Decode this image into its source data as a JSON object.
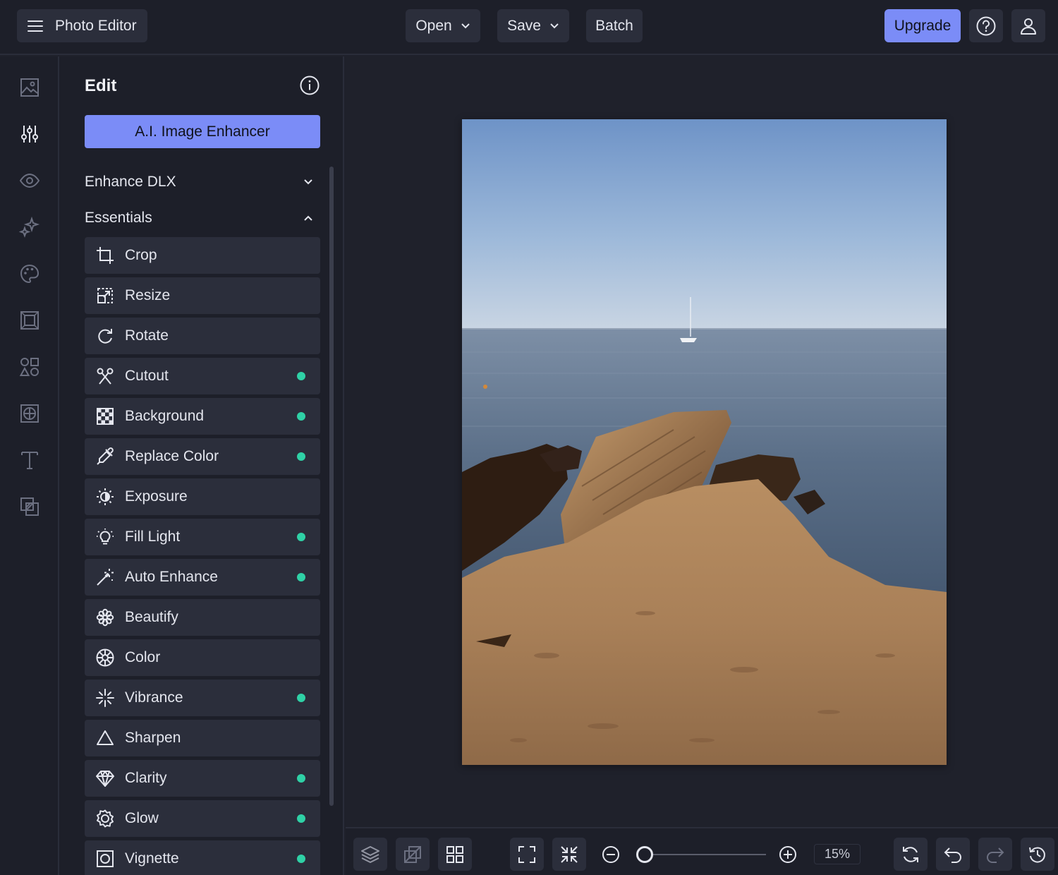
{
  "app": {
    "title": "Photo Editor"
  },
  "topbar": {
    "open_label": "Open",
    "save_label": "Save",
    "batch_label": "Batch",
    "upgrade_label": "Upgrade"
  },
  "rail": {
    "items": [
      "image-icon",
      "sliders-icon",
      "eye-icon",
      "sparkles-icon",
      "palette-icon",
      "frame-icon",
      "shapes-icon",
      "texture-icon",
      "text-icon",
      "overlay-icon"
    ],
    "active": "sliders-icon"
  },
  "panel": {
    "title": "Edit",
    "enhancer_label": "A.I. Image Enhancer",
    "sections": [
      {
        "label": "Enhance DLX",
        "expanded": false
      },
      {
        "label": "Essentials",
        "expanded": true
      }
    ],
    "tools": [
      {
        "label": "Crop",
        "icon": "crop-icon",
        "premium": false
      },
      {
        "label": "Resize",
        "icon": "resize-icon",
        "premium": false
      },
      {
        "label": "Rotate",
        "icon": "rotate-icon",
        "premium": false
      },
      {
        "label": "Cutout",
        "icon": "scissors-icon",
        "premium": true
      },
      {
        "label": "Background",
        "icon": "checkerboard-icon",
        "premium": true
      },
      {
        "label": "Replace Color",
        "icon": "eyedropper-icon",
        "premium": true
      },
      {
        "label": "Exposure",
        "icon": "exposure-icon",
        "premium": false
      },
      {
        "label": "Fill Light",
        "icon": "lightbulb-icon",
        "premium": true
      },
      {
        "label": "Auto Enhance",
        "icon": "magic-wand-icon",
        "premium": true
      },
      {
        "label": "Beautify",
        "icon": "flower-icon",
        "premium": false
      },
      {
        "label": "Color",
        "icon": "color-wheel-icon",
        "premium": false
      },
      {
        "label": "Vibrance",
        "icon": "burst-icon",
        "premium": true
      },
      {
        "label": "Sharpen",
        "icon": "triangle-icon",
        "premium": false
      },
      {
        "label": "Clarity",
        "icon": "diamond-icon",
        "premium": true
      },
      {
        "label": "Glow",
        "icon": "glow-icon",
        "premium": true
      },
      {
        "label": "Vignette",
        "icon": "vignette-icon",
        "premium": true
      }
    ]
  },
  "bottombar": {
    "zoom_value": "15%",
    "zoom_level": 0.02
  },
  "colors": {
    "accent": "#7b8cf7",
    "premium_dot": "#2fd1a6",
    "background": "#1f212b",
    "surface": "#2b2e3b"
  }
}
